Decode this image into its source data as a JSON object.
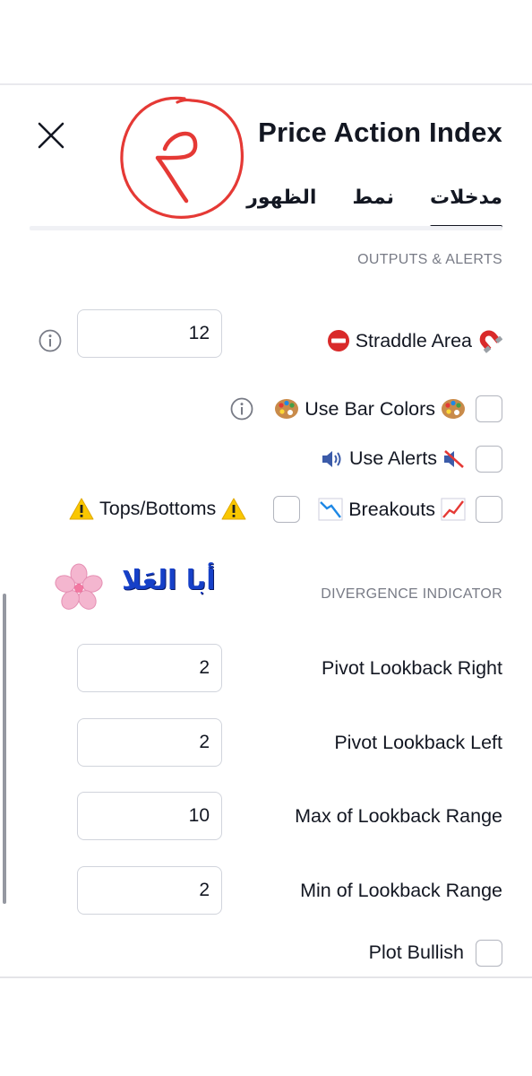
{
  "dialog": {
    "title": "Price Action Index",
    "tabs": [
      {
        "label": "مدخلات",
        "active": true
      },
      {
        "label": "نمط",
        "active": false
      },
      {
        "label": "الظهور",
        "active": false
      }
    ]
  },
  "sections": {
    "outputs": "OUTPUTS & ALERTS",
    "divergence": "DIVERGENCE INDICATOR"
  },
  "outputs": {
    "straddle": {
      "label": "Straddle Area",
      "value": "12",
      "icons": [
        "no-entry-icon",
        "magnet-icon"
      ]
    },
    "bar_colors": {
      "label": "Use Bar Colors",
      "checked": false,
      "icons": [
        "palette-icon",
        "palette-icon"
      ]
    },
    "alerts": {
      "label": "Use Alerts",
      "checked": false,
      "icons": [
        "speaker-icon",
        "muted-speaker-icon"
      ]
    },
    "breakouts": {
      "label": "Breakouts",
      "checked": false,
      "icons": [
        "chart-decreasing-icon",
        "chart-increasing-icon"
      ]
    },
    "tops_bottoms": {
      "label": "Tops/Bottoms",
      "checked": false,
      "icons": [
        "warning-icon",
        "warning-icon"
      ]
    }
  },
  "divergence": {
    "pivot_right": {
      "label": "Pivot Lookback Right",
      "value": "2"
    },
    "pivot_left": {
      "label": "Pivot Lookback Left",
      "value": "2"
    },
    "max_range": {
      "label": "Max of Lookback Range",
      "value": "10"
    },
    "min_range": {
      "label": "Min of Lookback Range",
      "value": "2"
    },
    "plot_bullish": {
      "label": "Plot Bullish",
      "checked": false
    }
  },
  "annotation": {
    "handwritten_number": "٢",
    "watermark_text": "أبا العَلا",
    "colors": {
      "red_circle": "#e53935",
      "watermark": "#1640c8",
      "flower": "#f4b6cf"
    }
  },
  "colors": {
    "text": "#131722",
    "muted": "#787b86",
    "border": "#d1d4dc",
    "accent_tab": "#131722"
  }
}
